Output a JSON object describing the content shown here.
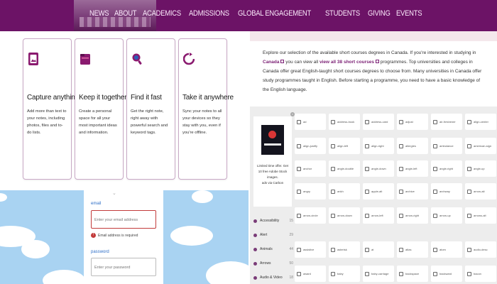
{
  "nav": {
    "links": [
      "NEWS",
      "ABOUT",
      "ACADEMICS",
      "ADMISSIONS",
      "GLOBAL ENGAGEMENT",
      "STUDENTS",
      "GIVING",
      "EVENTS"
    ]
  },
  "features": [
    {
      "title": "Capture anything",
      "text": "Add more than text to your notes, including photos, files and to-do lists.",
      "icon": "image-icon"
    },
    {
      "title": "Keep it together",
      "text": "Create a personal space for all your most important ideas and information.",
      "icon": "folder-icon"
    },
    {
      "title": "Find it fast",
      "text": "Get the right note, right away with powerful search and keyword tags.",
      "icon": "search-icon"
    },
    {
      "title": "Take it anywhere",
      "text": "Sync your notes to all your devices so they stay with you, even if you're offline.",
      "icon": "sync-icon"
    }
  ],
  "form": {
    "email_label": "email",
    "email_placeholder": "Enter your email address",
    "error_text": "Email address is required",
    "password_label": "password",
    "password_placeholder": "Enter your password"
  },
  "intro": {
    "t1": "Explore our selection of the available short courses degrees in Canada. If you're interested in studying in ",
    "country": "Canada",
    "t2": " you can view all ",
    "link": "view all 38 short courses",
    "t3": " programmes. Top universities and colleges in Canada offer great English-taught short courses degrees to choose from. Many universities in Canada offer study programmes taught in English. Before starting a programme, you need to have a basic knowledge of the English language."
  },
  "ad": {
    "text": "Limited time offer. Get 10 free Adobe Stock images.",
    "footer": "ads via Carbon"
  },
  "categories": [
    {
      "name": "Accessibility",
      "count": "15"
    },
    {
      "name": "Alert",
      "count": "29"
    },
    {
      "name": "Animals",
      "count": "44"
    },
    {
      "name": "Arrows",
      "count": "50"
    },
    {
      "name": "Audio & Video",
      "count": "18"
    }
  ],
  "tiles": [
    "ad",
    "address-book",
    "address-card",
    "adjust",
    "air-freshener",
    "align-center",
    "align-justify",
    "align-left",
    "align-right",
    "allergies",
    "ambulance",
    "american-sign",
    "anchor",
    "angle-double",
    "angle-down",
    "angle-left",
    "angle-right",
    "angle-up",
    "angry",
    "ankh",
    "apple-alt",
    "archive",
    "archway",
    "arrow-alt",
    "arrow-circle",
    "arrow-down",
    "arrow-left",
    "arrow-right",
    "arrow-up",
    "arrows-alt",
    "assistive",
    "asterisk",
    "at",
    "atlas",
    "atom",
    "audio-desc",
    "award",
    "baby",
    "baby-carriage",
    "backspace",
    "backward",
    "bacon"
  ]
}
